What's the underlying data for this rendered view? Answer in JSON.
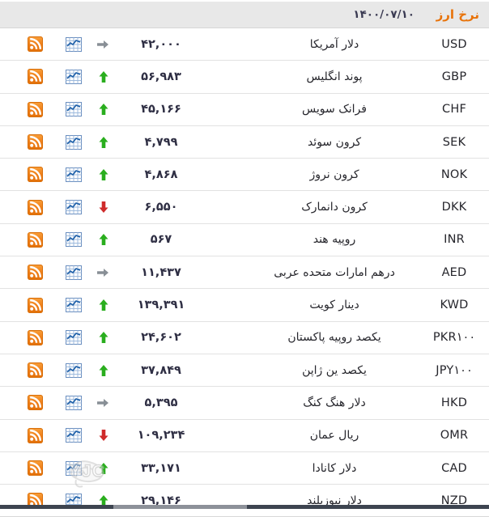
{
  "header": {
    "title": "نرخ ارز",
    "date": "۱۴۰۰/۰۷/۱۰",
    "title_color": "#e8730a",
    "background": "#e8e8e8"
  },
  "icons": {
    "rss": "rss-icon",
    "chart": "chart-icon",
    "up": "arrow-up-icon",
    "down": "arrow-down-icon",
    "flat": "arrow-right-icon"
  },
  "colors": {
    "up": "#2aae1e",
    "down": "#cf2b2b",
    "flat": "#888f96",
    "accent": "#e8730a",
    "value": "#2f2f44",
    "row_border": "#e2e2e2"
  },
  "watermark": {
    "text": "YJC"
  },
  "table": {
    "columns": [
      "rss",
      "chart",
      "trend",
      "value",
      "name",
      "code"
    ],
    "rows": [
      {
        "code": "USD",
        "name": "دلار آمریکا",
        "value": "۴۲,۰۰۰",
        "trend": "flat"
      },
      {
        "code": "GBP",
        "name": "پوند انگلیس",
        "value": "۵۶,۹۸۳",
        "trend": "up"
      },
      {
        "code": "CHF",
        "name": "فرانک سویس",
        "value": "۴۵,۱۶۶",
        "trend": "up"
      },
      {
        "code": "SEK",
        "name": "کرون سوئد",
        "value": "۴,۷۹۹",
        "trend": "up"
      },
      {
        "code": "NOK",
        "name": "کرون نروژ",
        "value": "۴,۸۶۸",
        "trend": "up"
      },
      {
        "code": "DKK",
        "name": "کرون دانمارک",
        "value": "۶,۵۵۰",
        "trend": "down"
      },
      {
        "code": "INR",
        "name": "روپیه هند",
        "value": "۵۶۷",
        "trend": "up"
      },
      {
        "code": "AED",
        "name": "درهم امارات متحده عربی",
        "value": "۱۱,۴۳۷",
        "trend": "flat"
      },
      {
        "code": "KWD",
        "name": "دینار کویت",
        "value": "۱۳۹,۳۹۱",
        "trend": "up"
      },
      {
        "code": "PKR۱۰۰",
        "name": "یکصد روپیه پاکستان",
        "value": "۲۴,۶۰۲",
        "trend": "up"
      },
      {
        "code": "JPY۱۰۰",
        "name": "یکصد ین ژاپن",
        "value": "۳۷,۸۴۹",
        "trend": "up"
      },
      {
        "code": "HKD",
        "name": "دلار هنگ کنگ",
        "value": "۵,۳۹۵",
        "trend": "flat"
      },
      {
        "code": "OMR",
        "name": "ریال عمان",
        "value": "۱۰۹,۲۳۴",
        "trend": "down"
      },
      {
        "code": "CAD",
        "name": "دلار کانادا",
        "value": "۳۳,۱۷۱",
        "trend": "up"
      },
      {
        "code": "NZD",
        "name": "دلار نیوزیلند",
        "value": "۲۹,۱۴۶",
        "trend": "up"
      }
    ]
  }
}
